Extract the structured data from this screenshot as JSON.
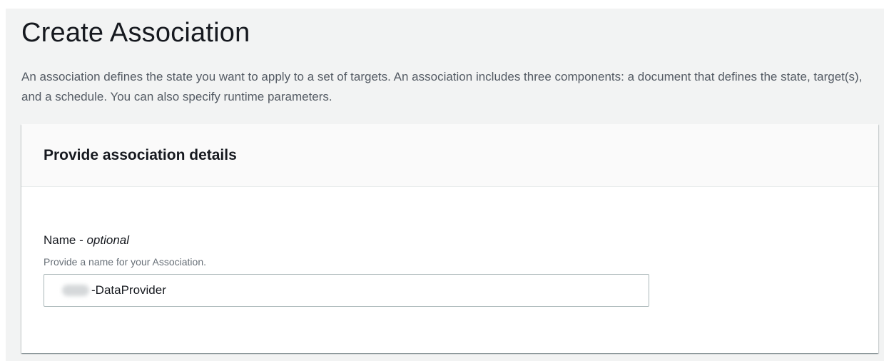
{
  "page": {
    "title": "Create Association",
    "description": "An association defines the state you want to apply to a set of targets. An association includes three components: a document that defines the state, target(s), and a schedule. You can also specify runtime parameters."
  },
  "panel": {
    "title": "Provide association details",
    "name_field": {
      "label": "Name - ",
      "label_optional": "optional",
      "help": "Provide a name for your Association.",
      "value": "-DataProvider"
    }
  },
  "colors": {
    "page_background": "#f2f3f3",
    "panel_header_background": "#fafafa",
    "text_primary": "#16191f",
    "text_secondary": "#545b64",
    "input_border": "#aab7b8"
  }
}
